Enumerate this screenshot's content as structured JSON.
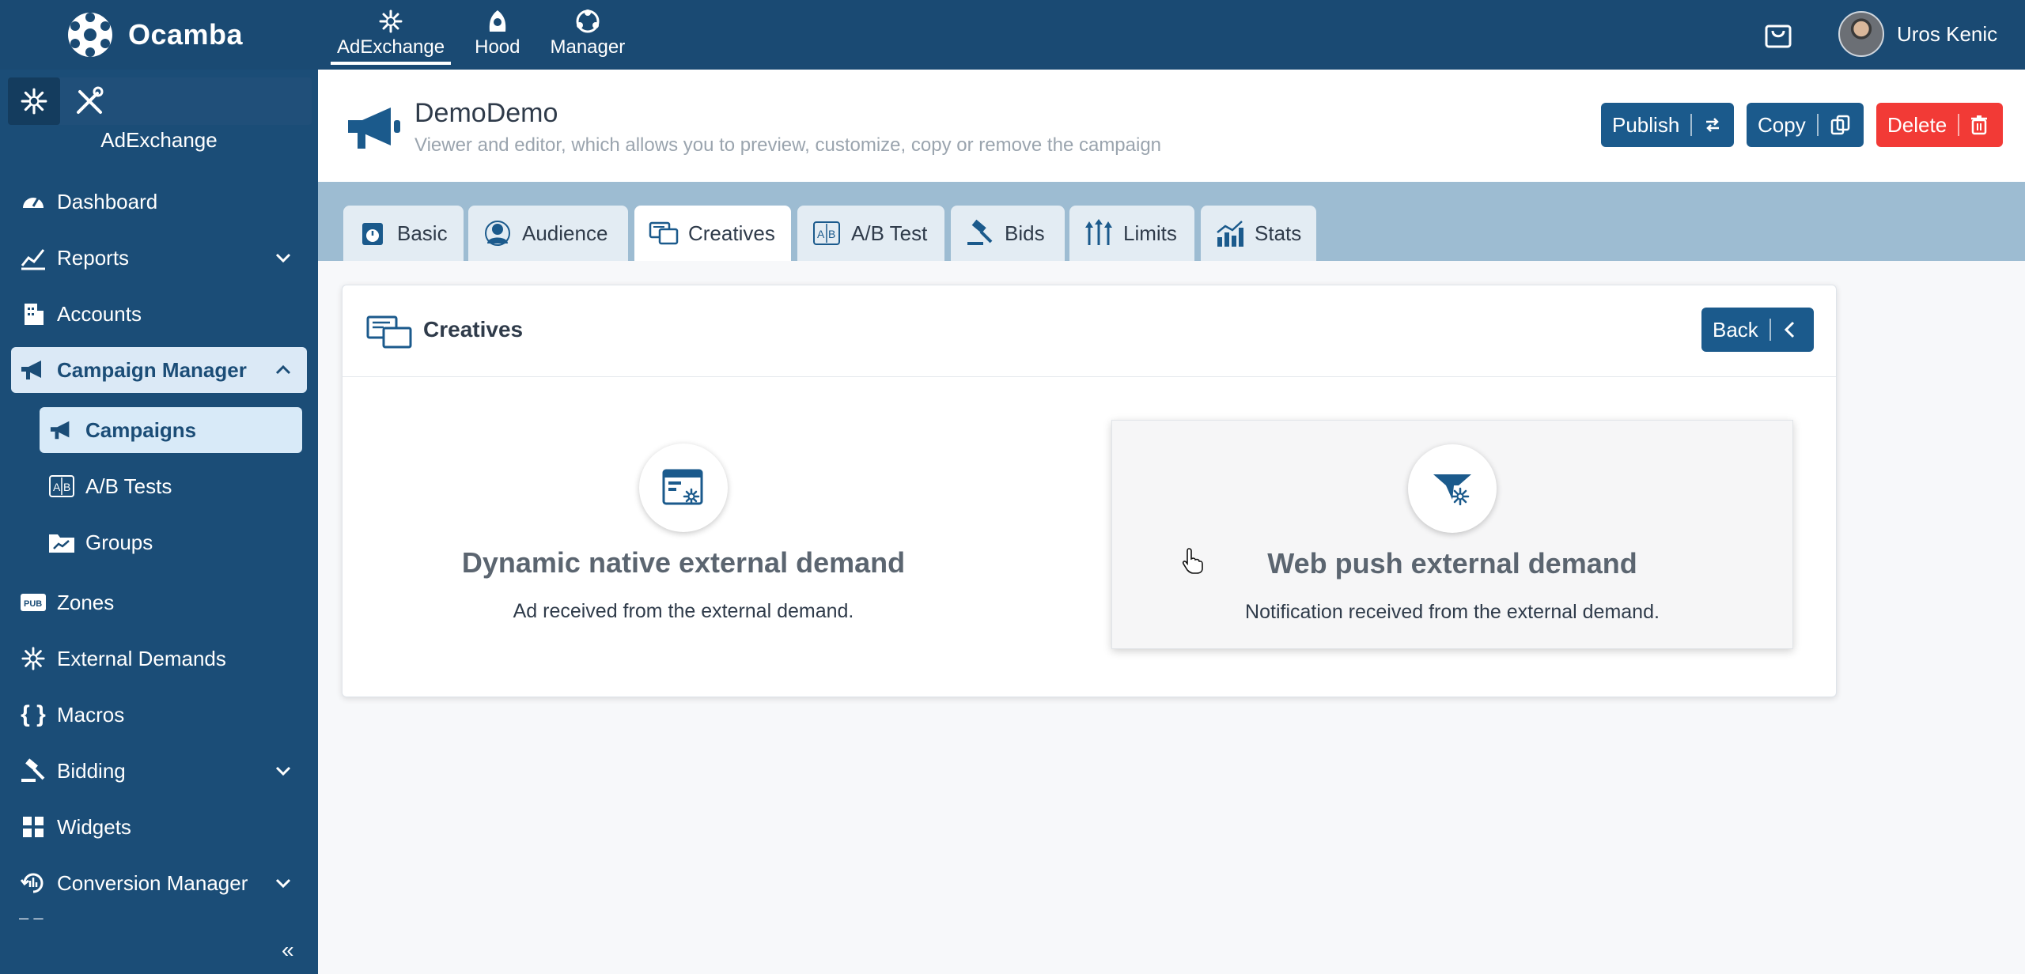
{
  "brand": {
    "name": "Ocamba"
  },
  "topnav": [
    {
      "label": "AdExchange",
      "icon": "adexchange-icon",
      "active": true
    },
    {
      "label": "Hood",
      "icon": "hood-icon",
      "active": false
    },
    {
      "label": "Manager",
      "icon": "manager-icon",
      "active": false
    }
  ],
  "user": {
    "name": "Uros Kenic"
  },
  "sidebar": {
    "title": "AdExchange",
    "items": [
      {
        "label": "Dashboard",
        "icon": "dashboard-icon"
      },
      {
        "label": "Reports",
        "icon": "reports-icon"
      },
      {
        "label": "Accounts",
        "icon": "accounts-icon"
      },
      {
        "label": "Campaign Manager",
        "icon": "megaphone-icon"
      },
      {
        "label": "Campaigns",
        "icon": "megaphone-icon"
      },
      {
        "label": "A/B Tests",
        "icon": "ab-test-icon"
      },
      {
        "label": "Groups",
        "icon": "folder-chart-icon"
      },
      {
        "label": "Zones",
        "icon": "pub-icon"
      },
      {
        "label": "External Demands",
        "icon": "spark-icon"
      },
      {
        "label": "Macros",
        "icon": "braces-icon"
      },
      {
        "label": "Bidding",
        "icon": "gavel-icon"
      },
      {
        "label": "Widgets",
        "icon": "grid-icon"
      },
      {
        "label": "Conversion Manager",
        "icon": "conversion-icon"
      }
    ],
    "collapse_glyph": "«",
    "dash_glyph": "– –"
  },
  "header": {
    "title": "DemoDemo",
    "subtitle": "Viewer and editor, which allows you to preview, customize, copy or remove the campaign",
    "publish_label": "Publish",
    "copy_label": "Copy",
    "delete_label": "Delete"
  },
  "tabs": [
    {
      "label": "Basic",
      "icon": "stopwatch-icon"
    },
    {
      "label": "Audience",
      "icon": "audience-icon"
    },
    {
      "label": "Creatives",
      "icon": "creatives-icon",
      "active": true
    },
    {
      "label": "A/B Test",
      "icon": "ab-test-icon"
    },
    {
      "label": "Bids",
      "icon": "gavel-icon"
    },
    {
      "label": "Limits",
      "icon": "limits-icon"
    },
    {
      "label": "Stats",
      "icon": "stats-icon"
    }
  ],
  "card": {
    "title": "Creatives",
    "back_label": "Back",
    "options": [
      {
        "title": "Dynamic native external demand",
        "desc": "Ad received from the external demand.",
        "icon": "browser-window-icon"
      },
      {
        "title": "Web push external demand",
        "desc": "Notification received from the external demand.",
        "icon": "funnel-push-icon"
      }
    ]
  },
  "colors": {
    "primary": "#1b4d77",
    "button_blue": "#1b5a8c",
    "danger": "#f23a36",
    "tabs_band": "#9dbcd2"
  }
}
